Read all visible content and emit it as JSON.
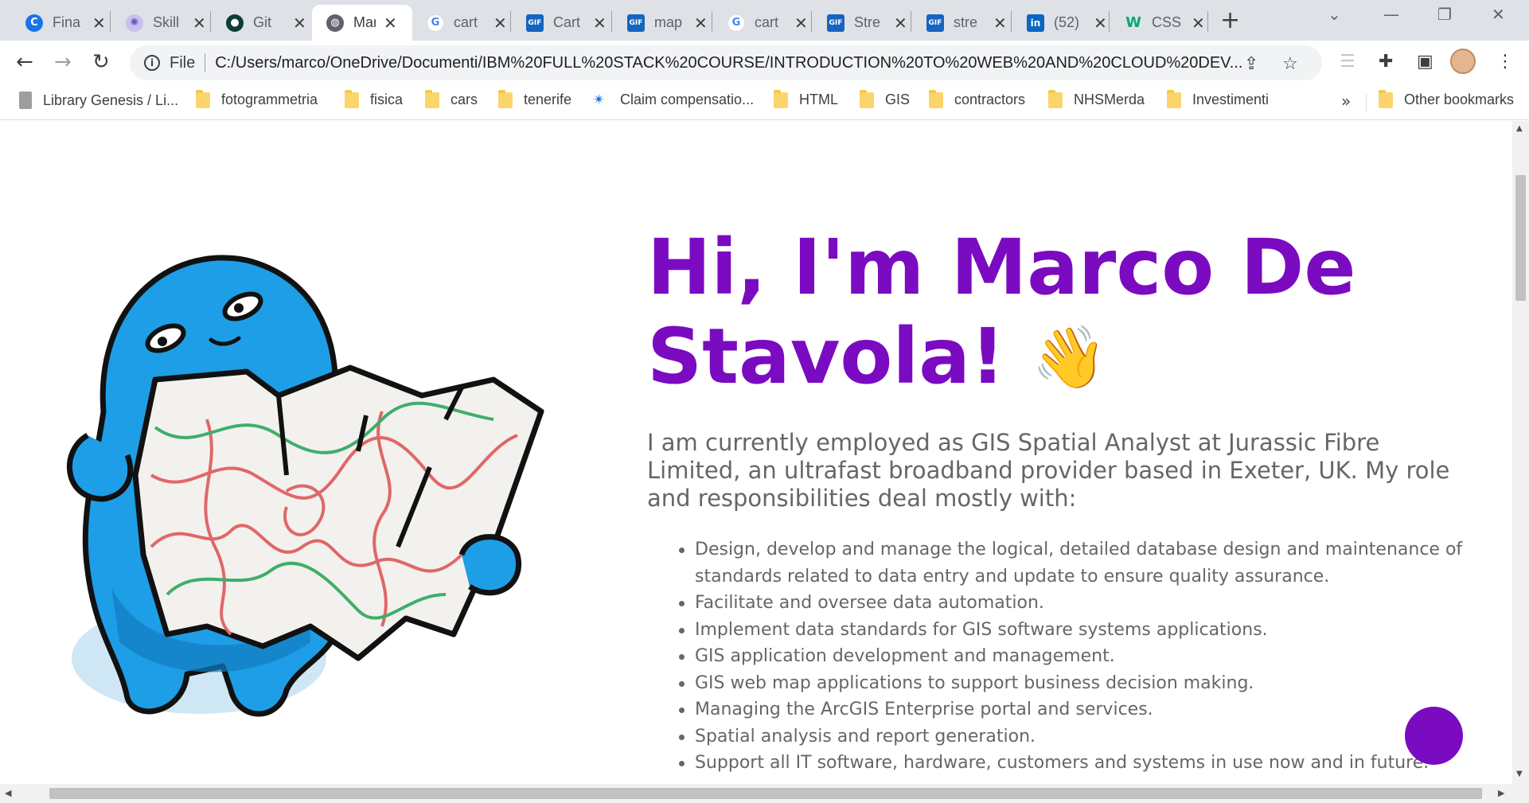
{
  "browser": {
    "tabs": [
      {
        "title": "Fina",
        "favicon": "chrome-c-icon",
        "color": "#1a73e8",
        "active": false
      },
      {
        "title": "Skill",
        "favicon": "skill-icon",
        "color": "#8e7cc3",
        "active": false
      },
      {
        "title": "Git",
        "favicon": "git-icon",
        "color": "#0b3d3a",
        "active": false
      },
      {
        "title": "Mar",
        "favicon": "globe-icon",
        "color": "#5f6368",
        "active": true
      },
      {
        "title": "cart",
        "favicon": "google-icon",
        "color": "#4285f4",
        "active": false
      },
      {
        "title": "Cart",
        "favicon": "gif-icon",
        "color": "#1565c0",
        "active": false
      },
      {
        "title": "map",
        "favicon": "gif-icon",
        "color": "#1565c0",
        "active": false
      },
      {
        "title": "cart",
        "favicon": "google-icon",
        "color": "#4285f4",
        "active": false
      },
      {
        "title": "Stre",
        "favicon": "gif-icon",
        "color": "#1565c0",
        "active": false
      },
      {
        "title": "stre",
        "favicon": "gif-icon",
        "color": "#1565c0",
        "active": false
      },
      {
        "title": "(52)",
        "favicon": "linkedin-icon",
        "color": "#0a66c2",
        "active": false
      },
      {
        "title": "CSS",
        "favicon": "w3schools-icon",
        "color": "#04aa6d",
        "active": false
      }
    ],
    "omnibox": {
      "scheme_label": "File",
      "url": "C:/Users/marco/OneDrive/Documenti/IBM%20FULL%20STACK%20COURSE/INTRODUCTION%20TO%20WEB%20AND%20CLOUD%20DEV..."
    },
    "bookmarks": [
      {
        "label": "Library Genesis / Li...",
        "icon": "book-icon"
      },
      {
        "label": "fotogrammetria",
        "icon": "folder-icon"
      },
      {
        "label": "fisica",
        "icon": "folder-icon"
      },
      {
        "label": "cars",
        "icon": "folder-icon"
      },
      {
        "label": "tenerife",
        "icon": "folder-icon"
      },
      {
        "label": "Claim compensatio...",
        "icon": "star-burst-icon"
      },
      {
        "label": "HTML",
        "icon": "folder-icon"
      },
      {
        "label": "GIS",
        "icon": "folder-icon"
      },
      {
        "label": "contractors",
        "icon": "folder-icon"
      },
      {
        "label": "NHSMerda",
        "icon": "folder-icon"
      },
      {
        "label": "Investimenti",
        "icon": "folder-icon"
      }
    ],
    "bookmarks_overflow": "»",
    "other_bookmarks": "Other bookmarks"
  },
  "page": {
    "title_line1": "Hi, I'm Marco De",
    "title_line2": "Stavola!",
    "wave_emoji": "👋",
    "intro": "I am currently employed as GIS Spatial Analyst at Jurassic Fibre Limited, an ultrafast broadband provider based in Exeter, UK. My role and responsibilities deal mostly with:",
    "duties": [
      "Design, develop and manage the logical, detailed database design and maintenance of standards related to data entry and update to ensure quality assurance.",
      "Facilitate and oversee data automation.",
      "Implement data standards for GIS software systems applications.",
      "GIS application development and management.",
      "GIS web map applications to support business decision making.",
      "Managing the ArcGIS Enterprise portal and services.",
      "Spatial analysis and report generation.",
      "Support all IT software, hardware, customers and systems in use now and in future."
    ],
    "accent_color": "#7a0bc0",
    "text_color": "#666666"
  }
}
